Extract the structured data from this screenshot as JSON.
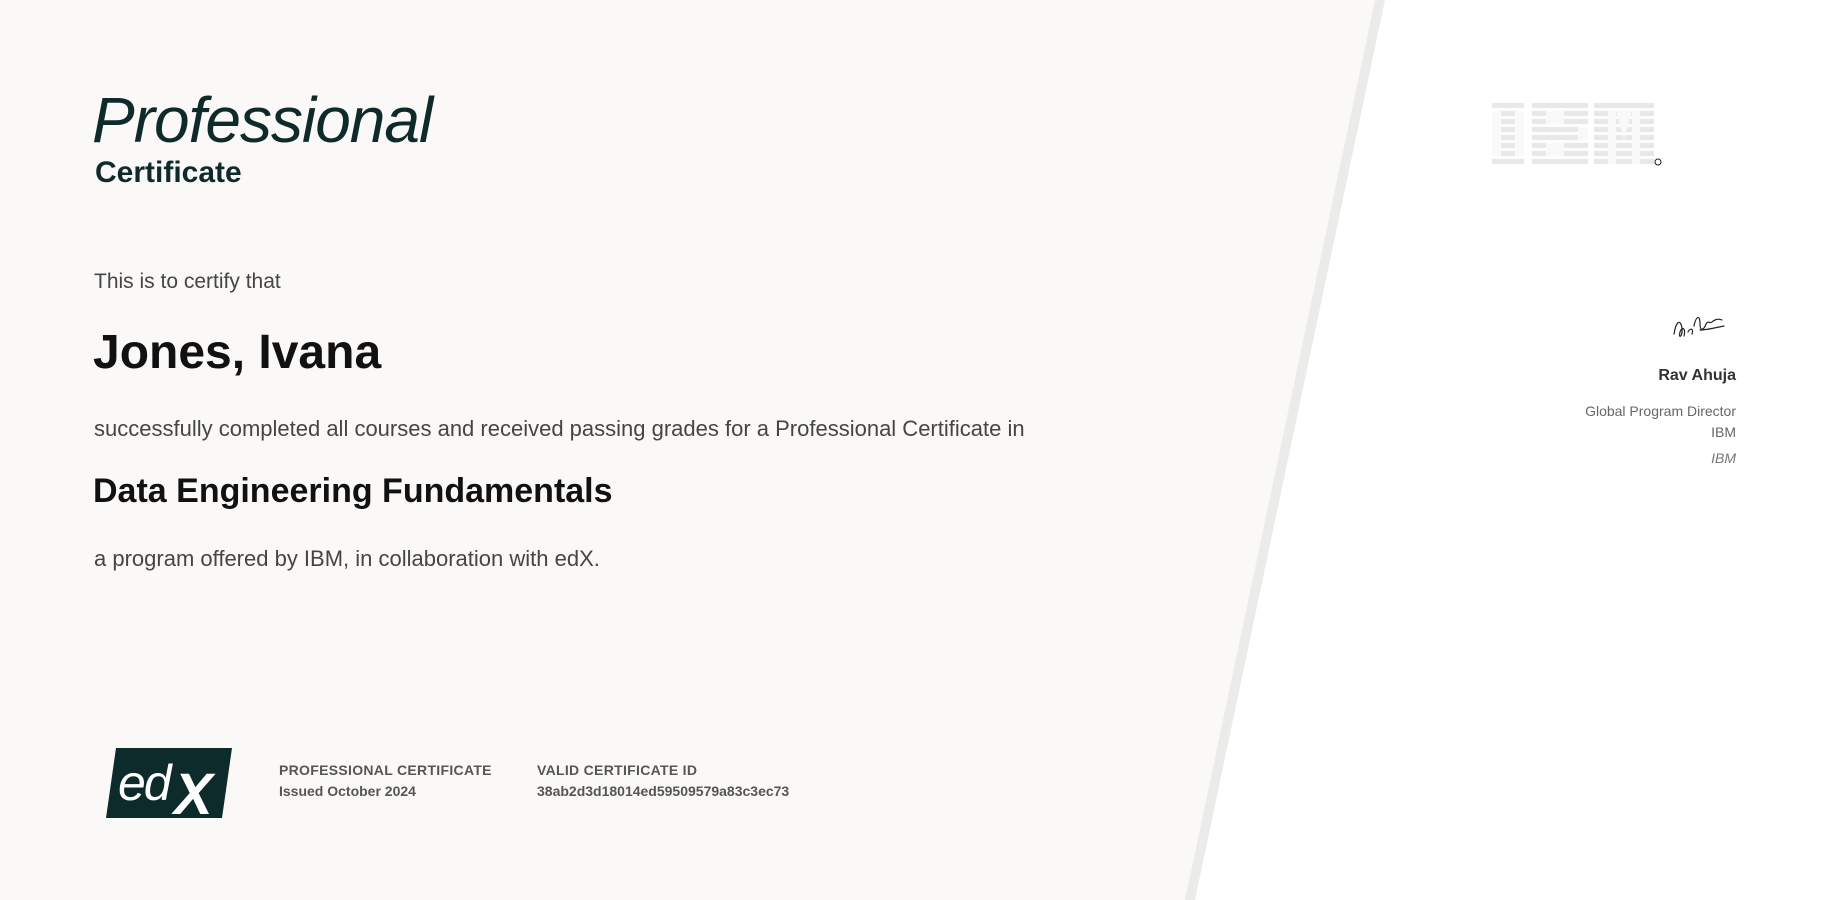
{
  "header": {
    "title_line1": "Professional",
    "title_line2": "Certificate"
  },
  "body": {
    "intro": "This is to certify that",
    "recipient_name": "Jones, Ivana",
    "completion_statement": "successfully completed all courses and received passing grades for a Professional Certificate in",
    "program_name": "Data Engineering Fundamentals",
    "offered_by": "a program offered by IBM, in collaboration with edX."
  },
  "issuer": {
    "logo_text": "IBM",
    "logo_icon": "ibm-logo-icon",
    "signer_name": "Rav Ahuja",
    "signer_title": "Global Program Director",
    "signer_org": "IBM",
    "signer_org_italic": "IBM"
  },
  "footer": {
    "platform_logo_text": "edX",
    "platform_logo_icon": "edx-logo-icon",
    "certificate_type_label": "PROFESSIONAL CERTIFICATE",
    "issued_text": "Issued October 2024",
    "certificate_id_label": "VALID CERTIFICATE ID",
    "certificate_id": "38ab2d3d18014ed59509579a83c3ec73"
  },
  "colors": {
    "left_panel_bg": "#faf9f7",
    "right_panel_bg": "#ffffff",
    "divider": "#ebebe9",
    "brand_dark": "#0f2a2a",
    "edx_bg": "#0d2b2b"
  }
}
